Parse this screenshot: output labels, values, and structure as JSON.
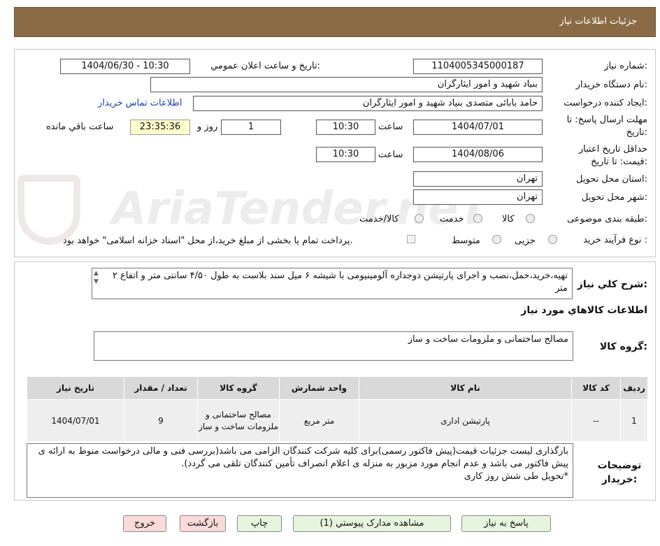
{
  "header": {
    "title": "جزئیات اطلاعات نیاز"
  },
  "watermark": {
    "text": "AriaTender.neT"
  },
  "form": {
    "need_number_label": "شماره نیاز:",
    "need_number": "1104005345000187",
    "announce_label": "تاریخ و ساعت اعلان عمومي:",
    "announce_value": "1404/06/30 - 10:30",
    "buyer_org_label": "نام دستگاه خریدار:",
    "buyer_org": "بنیاد شهید و امور ایثارگران",
    "creator_label": "ایجاد کننده درخواست:",
    "creator": "حامد بابائی متصدی بنیاد شهید و امور ایثارگران",
    "contact_link": "اطلاعات تماس خریدار",
    "deadline_label": "مهلت ارسال پاسخ: تا تاریخ:",
    "deadline_date": "1404/07/01",
    "time_label": "ساعت",
    "deadline_time": "10:30",
    "days_value": "1",
    "day_and_label": "روز و",
    "remaining_time": "23:35:36",
    "remaining_label": "ساعت باقي مانده",
    "validity_label": "حداقل تاریخ اعتبار قیمت: تا تاریخ:",
    "validity_date": "1404/08/06",
    "validity_time": "10:30",
    "province_label": "استان محل تحویل:",
    "province": "تهران",
    "city_label": "شهر محل تحویل:",
    "city": "تهران",
    "category_label": "طبقه بندی موضوعی:",
    "category_options": [
      "کالا",
      "خدمت",
      "کالا/خدمت"
    ],
    "process_label": "نوع فرآیند خرید :",
    "process_options": [
      "جزیی",
      "متوسط"
    ],
    "payment_note": "پرداخت تمام یا بخشی از مبلغ خرید،از محل \"اسناد خزانه اسلامی\" خواهد بود."
  },
  "description": {
    "label": "شرح کلي نياز:",
    "text": "تهیه،خرید،حمل،نصب و اجرای پارتیشن دوجداره آلومینیومی با شیشه ۶ میل سند بلاست به طول ۴/۵۰ سانتی متر و اتفاع ۲ متر"
  },
  "goods": {
    "section_title": "اطلاعات کالاهاي مورد نياز",
    "group_label": "گروه کالا:",
    "group_value": "مصالح ساختمانی و ملزومات ساخت و ساز",
    "table": {
      "headers": [
        "ردیف",
        "کد کالا",
        "نام کالا",
        "واحد شمارش",
        "گروه کالا",
        "تعداد / مقدار",
        "تاریخ نیاز"
      ],
      "rows": [
        [
          "1",
          "--",
          "پارتیشن اداری",
          "متر مربع",
          "مصالح ساختمانی و ملزومات ساخت و ساز",
          "9",
          "1404/07/01"
        ]
      ]
    }
  },
  "buyer_notes": {
    "label": "توضیحات خریدار:",
    "text": "بارگذاری لیست جزئیات قیمت(پیش فاکتور رسمی)برای کلیه شرکت کنندگان الزامی می باشد(بررسی فنی و مالی درخواست منوط به ارائه ی پیش فاکتور می باشد و عدم انجام مورد مزبور به منزله ی اعلام انصراف تأمین کنندگان تلقی می گردد).\n*تحویل طی شش روز کاری"
  },
  "buttons": {
    "reply": "پاسخ به نیاز",
    "view_docs": "مشاهده مدارک پیوستي (1)",
    "print": "چاپ",
    "back": "بازگشت",
    "exit": "خروج"
  },
  "colors": {
    "header_bg": "#8b6b45",
    "time_bg": "#ffffcc",
    "green_button": "#e6f5de",
    "pink_button": "#fbdada",
    "link": "#1a3fb8"
  }
}
